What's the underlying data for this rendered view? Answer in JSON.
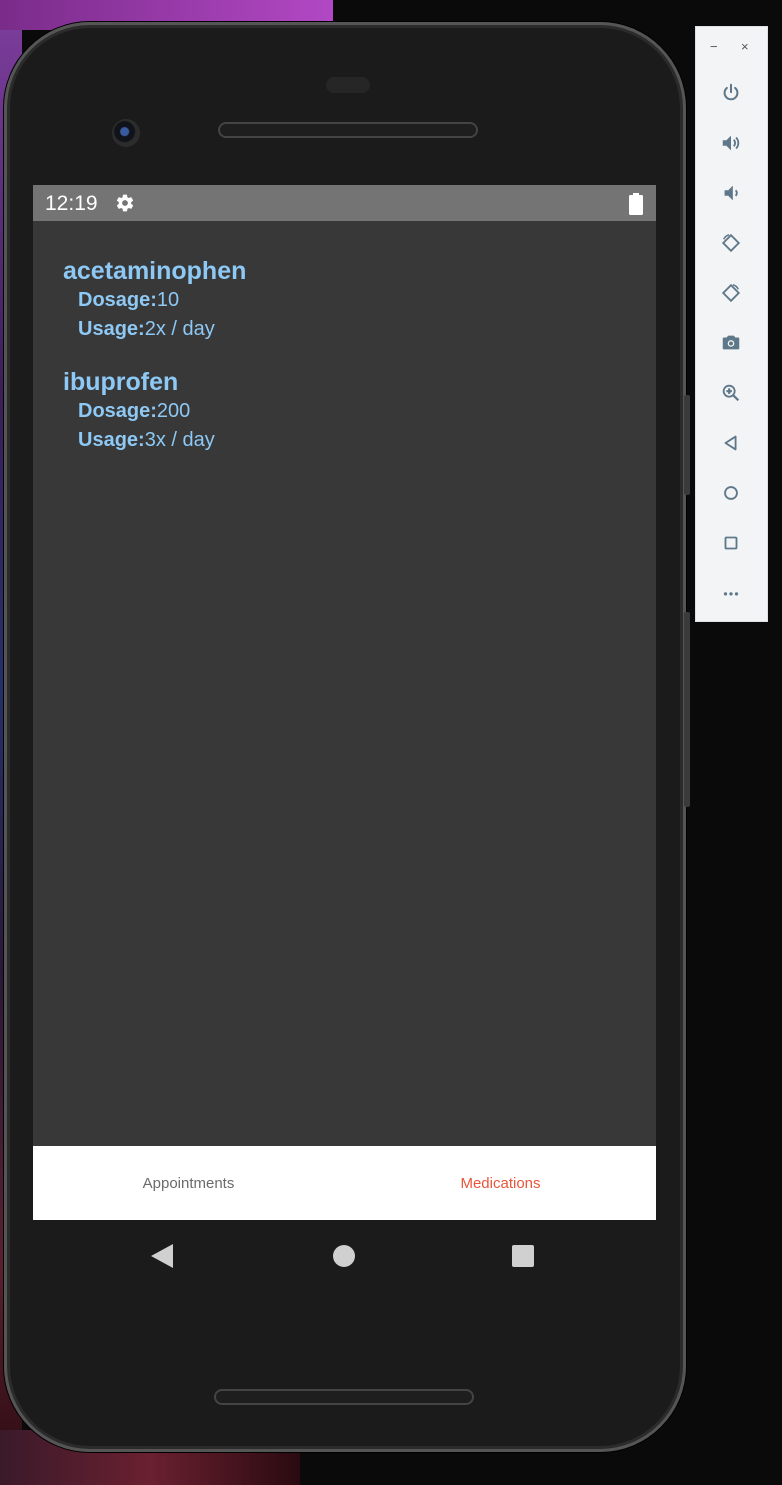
{
  "status_bar": {
    "time": "12:19",
    "icons": [
      "gear-icon",
      "battery-icon"
    ]
  },
  "medications": [
    {
      "name": "acetaminophen",
      "dosage_label": "Dosage:",
      "dosage": "10",
      "usage_label": "Usage:",
      "usage": "2x / day"
    },
    {
      "name": "ibuprofen",
      "dosage_label": "Dosage:",
      "dosage": "200",
      "usage_label": "Usage:",
      "usage": "3x / day"
    }
  ],
  "tabs": [
    {
      "label": "Appointments",
      "active": false
    },
    {
      "label": "Medications",
      "active": true
    }
  ],
  "colors": {
    "accent_tab": "#e8553a",
    "inactive_tab": "#6b6b6b",
    "med_text": "#8ec8f4",
    "screen_bg": "#383838",
    "status_bar_bg": "#747474"
  },
  "emulator_toolbar": {
    "window_controls": [
      "−",
      "×"
    ],
    "buttons": [
      "power-icon",
      "volume-up-icon",
      "volume-down-icon",
      "rotate-left-icon",
      "rotate-right-icon",
      "camera-icon",
      "zoom-icon",
      "back-icon",
      "home-icon",
      "overview-icon",
      "more-icon"
    ]
  },
  "nav_bar": {
    "buttons": [
      "back-icon",
      "home-icon",
      "recents-icon"
    ]
  }
}
